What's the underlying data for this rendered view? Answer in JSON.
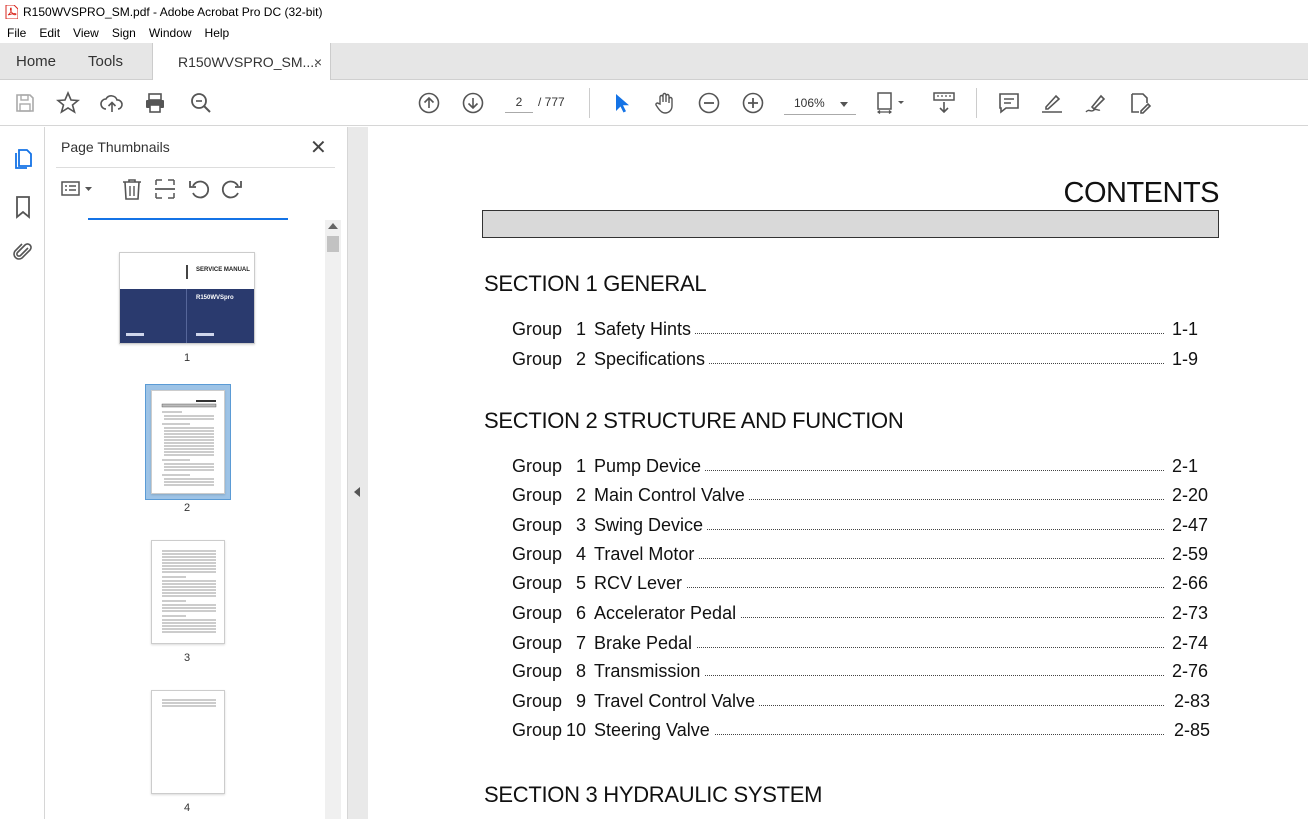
{
  "window": {
    "title": "R150WVSPRO_SM.pdf - Adobe Acrobat Pro DC (32-bit)"
  },
  "menu": [
    "File",
    "Edit",
    "View",
    "Sign",
    "Window",
    "Help"
  ],
  "tabs": {
    "home": "Home",
    "tools": "Tools",
    "document": "R150WVSPRO_SM....",
    "close": "×"
  },
  "toolbar": {
    "current_page": "2",
    "total_pages": "/ 777",
    "zoom": "106%"
  },
  "thumbnail_panel": {
    "title": "Page Thumbnails",
    "close": "✕",
    "thumbnails": [
      {
        "label": "1",
        "cover_title": "SERVICE MANUAL",
        "cover_model": "R150WVSpro"
      },
      {
        "label": "2"
      },
      {
        "label": "3"
      },
      {
        "label": "4"
      }
    ]
  },
  "document": {
    "heading": "CONTENTS",
    "sections": [
      {
        "title": "SECTION 1  GENERAL",
        "items": [
          {
            "group": "Group",
            "num": "1",
            "title": "Safety Hints",
            "page": "1-1"
          },
          {
            "group": "Group",
            "num": "2",
            "title": "Specifications",
            "page": "1-9"
          }
        ]
      },
      {
        "title": "SECTION 2  STRUCTURE AND FUNCTION",
        "items": [
          {
            "group": "Group",
            "num": "1",
            "title": "Pump Device",
            "page": "2-1"
          },
          {
            "group": "Group",
            "num": "2",
            "title": "Main Control Valve",
            "page": "2-20"
          },
          {
            "group": "Group",
            "num": "3",
            "title": "Swing Device",
            "page": "2-47"
          },
          {
            "group": "Group",
            "num": "4",
            "title": "Travel Motor",
            "page": "2-59"
          },
          {
            "group": "Group",
            "num": "5",
            "title": "RCV Lever",
            "page": "2-66"
          },
          {
            "group": "Group",
            "num": "6",
            "title": "Accelerator Pedal",
            "page": "2-73"
          },
          {
            "group": "Group",
            "num": "7",
            "title": "Brake Pedal",
            "page": "2-74"
          },
          {
            "group": "Group",
            "num": "8",
            "title": "Transmission",
            "page": "2-76"
          },
          {
            "group": "Group",
            "num": "9",
            "title": "Travel Control Valve",
            "page": "2-83"
          },
          {
            "group": "Group",
            "num": "10",
            "title": "Steering Valve",
            "page": "2-85"
          }
        ]
      },
      {
        "title": "SECTION 3  HYDRAULIC SYSTEM",
        "items": []
      }
    ]
  },
  "colors": {
    "accent": "#1473e6",
    "cover_blue": "#2a3a6e",
    "thumb_selected": "#9dc3e6",
    "pdf_red": "#d9261c"
  }
}
